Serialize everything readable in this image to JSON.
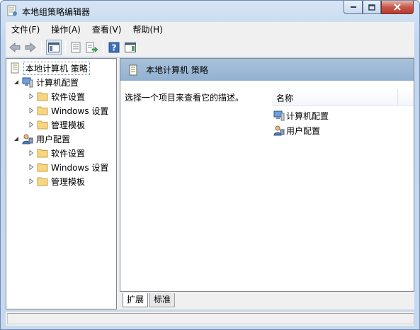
{
  "window": {
    "title": "本地组策略编辑器",
    "icon": "group-policy-editor-icon"
  },
  "title_controls": [
    "minimize-icon",
    "maximize-icon",
    "close-icon"
  ],
  "menubar": {
    "items": [
      {
        "label": "文件(F)"
      },
      {
        "label": "操作(A)"
      },
      {
        "label": "查看(V)"
      },
      {
        "label": "帮助(H)"
      }
    ]
  },
  "toolbar": {
    "icons": [
      "back-arrow-icon",
      "forward-arrow-icon",
      "show-hide-tree-icon",
      "properties-icon",
      "export-list-icon",
      "help-icon",
      "show-hide-action-pane-icon"
    ]
  },
  "tree": {
    "root": {
      "label": "本地计算机 策略",
      "icon": "policy-document-icon"
    },
    "computer_config": {
      "label": "计算机配置",
      "icon": "computer-icon",
      "children": [
        {
          "label": "软件设置",
          "icon": "folder-icon"
        },
        {
          "label": "Windows 设置",
          "icon": "folder-icon"
        },
        {
          "label": "管理模板",
          "icon": "folder-icon"
        }
      ]
    },
    "user_config": {
      "label": "用户配置",
      "icon": "user-icon",
      "children": [
        {
          "label": "软件设置",
          "icon": "folder-icon"
        },
        {
          "label": "Windows 设置",
          "icon": "folder-icon"
        },
        {
          "label": "管理模板",
          "icon": "folder-icon"
        }
      ]
    }
  },
  "detail": {
    "banner_title": "本地计算机 策略",
    "description": "选择一个项目来查看它的描述。",
    "column_header": "名称",
    "items": [
      {
        "label": "计算机配置",
        "icon": "computer-icon"
      },
      {
        "label": "用户配置",
        "icon": "user-icon"
      }
    ]
  },
  "tabs": [
    {
      "label": "扩展",
      "active": true
    },
    {
      "label": "标准",
      "active": false
    }
  ],
  "colors": {
    "banner": "#9db9d6",
    "window_frame": "#c2d6ee",
    "close_button": "#c7574a"
  }
}
